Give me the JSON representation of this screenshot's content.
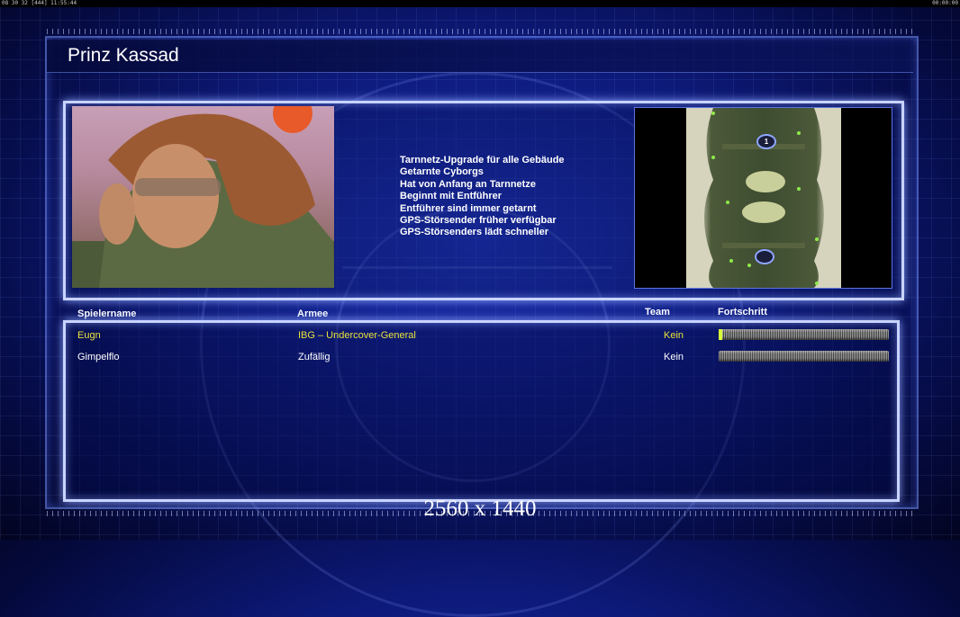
{
  "topbar": {
    "left_text": "08 30 32 [444] 11:55:44",
    "right_text": "00:00:00"
  },
  "title": "Prinz Kassad",
  "general_features": [
    "Tarnnetz-Upgrade für alle Gebäude",
    "Getarnte Cyborgs",
    "Hat von Anfang an Tarnnetze",
    "Beginnt mit Entführer",
    "Entführer sind immer getarnt",
    "GPS-Störsender früher verfügbar",
    "GPS-Störsenders lädt schneller"
  ],
  "map": {
    "start_marker_1": "1",
    "start_marker_2": ""
  },
  "table": {
    "headers": {
      "player": "Spielername",
      "army": "Armee",
      "team": "Team",
      "progress": "Fortschritt"
    },
    "rows": [
      {
        "name": "Eugn",
        "army": "IBG – Undercover-General",
        "team": "Kein",
        "progress": 0.02,
        "color": "#e8e23a"
      },
      {
        "name": "Gimpelflo",
        "army": "Zufällig",
        "team": "Kein",
        "progress": 0.0,
        "color": "#ffffff"
      }
    ]
  },
  "resolution_label": "2560 x 1440",
  "colors": {
    "frame": "#c8d4ff",
    "background": "#0d1a7a",
    "highlight_player": "#e8e23a",
    "progress_fill": "#d7ff3a"
  }
}
